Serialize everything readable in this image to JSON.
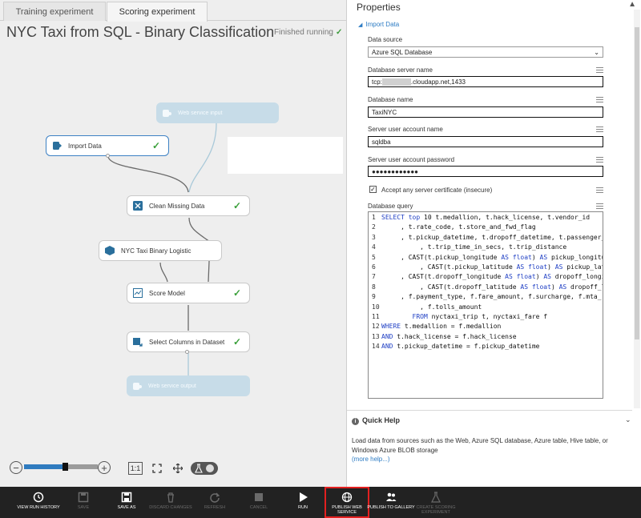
{
  "tabs": [
    {
      "label": "Training experiment"
    },
    {
      "label": "Scoring experiment"
    }
  ],
  "experiment": {
    "title": "NYC Taxi from SQL - Binary Classification",
    "status": "Finished running"
  },
  "modules": {
    "web_service_input": "Web service input",
    "import_data": "Import Data",
    "clean_missing": "Clean Missing Data",
    "nyc_taxi": "NYC Taxi Binary Logistic",
    "score_model": "Score Model",
    "select_columns": "Select Columns in Dataset",
    "web_service_output": "Web service output"
  },
  "canvas_tools": {
    "zoom_minus": "−",
    "zoom_plus": "+",
    "actual_size": "1:1",
    "zoom_level": 0.55
  },
  "properties": {
    "title": "Properties",
    "section": "Import Data",
    "data_source_label": "Data source",
    "data_source_value": "Azure SQL Database",
    "server_name_label": "Database server name",
    "server_name_prefix": "tcp:",
    "server_name_masked": "xxxxxxxxx",
    "server_name_suffix": ".cloudapp.net,1433",
    "database_name_label": "Database name",
    "database_name_value": "TaxiNYC",
    "account_label": "Server user account name",
    "account_value": "sqldba",
    "password_label": "Server user account password",
    "password_value": "●●●●●●●●●●●●",
    "accept_cert_label": "Accept any server certificate (insecure)",
    "accept_cert_checked": true,
    "query_label": "Database query",
    "query_lines": [
      "SELECT top 10 t.medallion, t.hack_license, t.vendor_id",
      "     , t.rate_code, t.store_and_fwd_flag",
      "     , t.pickup_datetime, t.dropoff_datetime, t.passenger_c",
      "          , t.trip_time_in_secs, t.trip_distance",
      "     , CAST(t.pickup_longitude AS float) AS pickup_longitu",
      "          , CAST(t.pickup_latitude AS float) AS pickup_lati",
      "     , CAST(t.dropoff_longitude AS float) AS dropoff_longi",
      "          , CAST(t.dropoff_latitude AS float) AS dropoff_la",
      "     , f.payment_type, f.fare_amount, f.surcharge, f.mta_",
      "          , f.tolls_amount",
      "        FROM nyctaxi_trip t, nyctaxi_fare f",
      "WHERE t.medallion = f.medallion",
      "AND t.hack_license = f.hack_license",
      "AND t.pickup_datetime = f.pickup_datetime"
    ]
  },
  "quick_help": {
    "title": "Quick Help",
    "text": "Load data from sources such as the Web, Azure SQL database, Azure table, Hive table, or Windows Azure BLOB storage",
    "more": "(more help...)"
  },
  "toolbar": [
    {
      "label": "VIEW RUN HISTORY",
      "icon": "clock-icon",
      "enabled": true
    },
    {
      "label": "SAVE",
      "icon": "save-icon",
      "enabled": false
    },
    {
      "label": "SAVE AS",
      "icon": "save-as-icon",
      "enabled": true
    },
    {
      "label": "DISCARD CHANGES",
      "icon": "trash-icon",
      "enabled": false
    },
    {
      "label": "REFRESH",
      "icon": "refresh-icon",
      "enabled": false
    },
    {
      "label": "CANCEL",
      "icon": "stop-icon",
      "enabled": false
    },
    {
      "label": "RUN",
      "icon": "play-icon",
      "enabled": true
    },
    {
      "label": "PUBLISH WEB SERVICE",
      "icon": "globe-icon",
      "enabled": true,
      "highlighted": true
    },
    {
      "label": "PUBLISH TO GALLERY",
      "icon": "people-icon",
      "enabled": true
    },
    {
      "label": "CREATE SCORING EXPERIMENT",
      "icon": "flask-icon",
      "enabled": false
    }
  ],
  "colors": {
    "accent": "#2d7cc4",
    "success": "#3ba03b",
    "highlight": "#e32020",
    "toolbar_bg": "#222222"
  }
}
